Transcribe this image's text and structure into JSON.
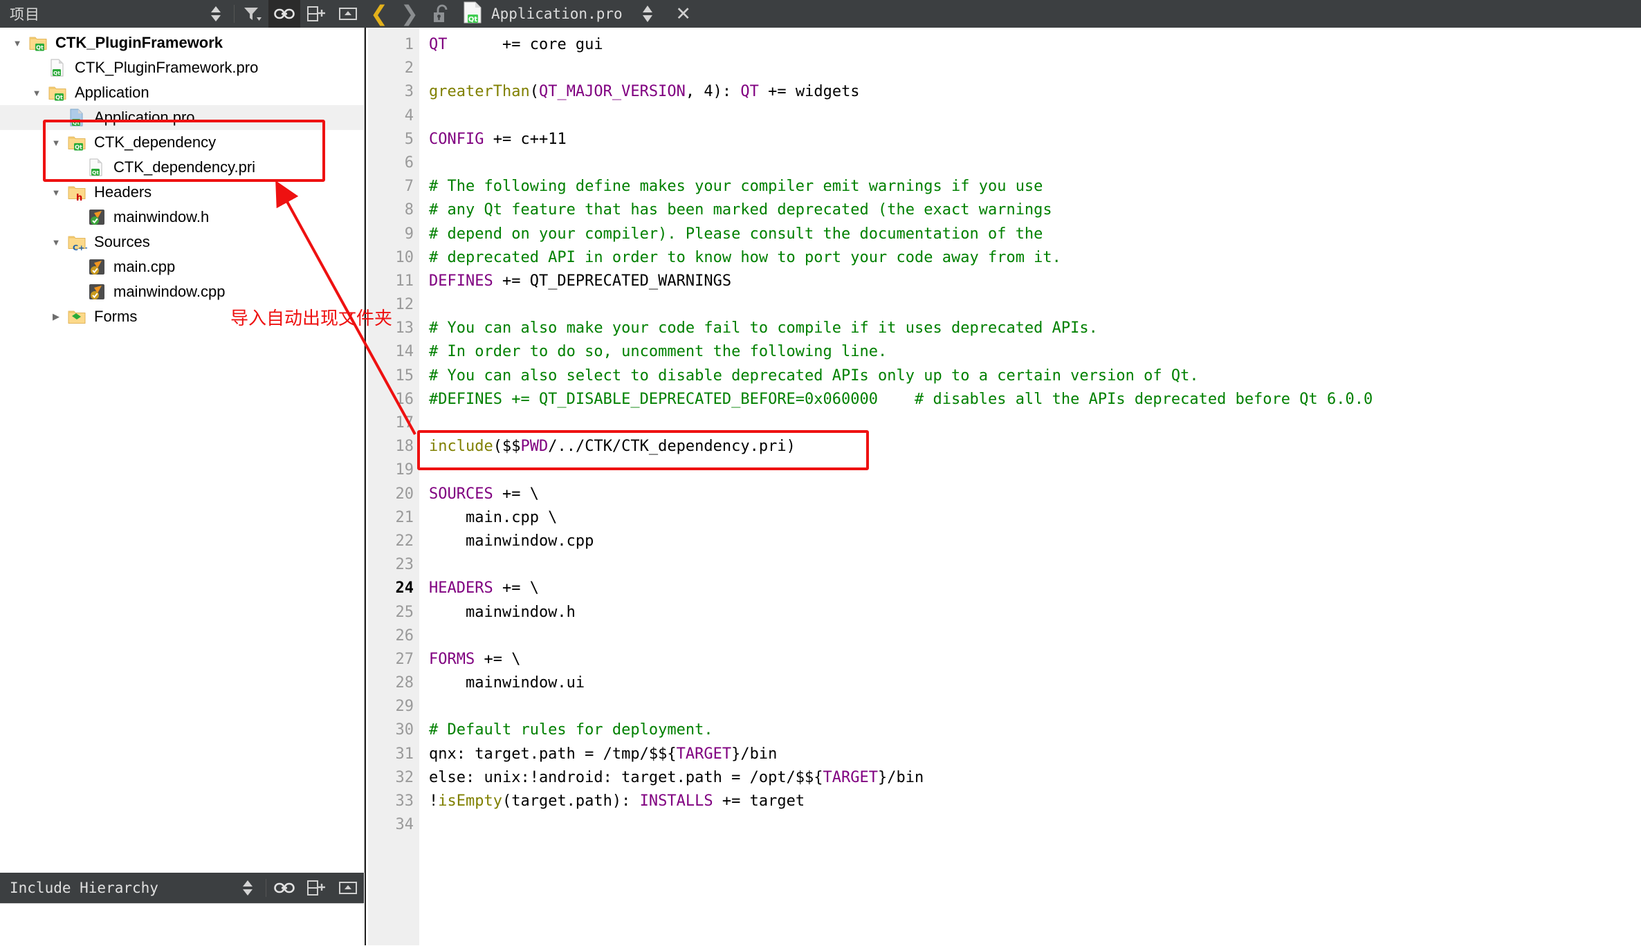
{
  "sidebar_header": {
    "title": "项目",
    "icons": [
      "sort-updown-icon",
      "filter-icon",
      "link-icon",
      "split-add-icon",
      "minimize-icon"
    ]
  },
  "editor_toolbar": {
    "back_icon": "chevron-left-icon",
    "forward_icon": "chevron-right-icon",
    "lock_icon": "unlock-icon",
    "file_icon": "qt-file-icon",
    "filename": "Application.pro",
    "updown_icon": "sort-updown-icon",
    "close_icon": "close-icon"
  },
  "tree": [
    {
      "label": "CTK_PluginFramework",
      "indent": 0,
      "arrow": "down",
      "icon": "qt-folder-icon",
      "bold": true,
      "selected": false
    },
    {
      "label": "CTK_PluginFramework.pro",
      "indent": 1,
      "arrow": "none",
      "icon": "qt-file-icon",
      "bold": false,
      "selected": false
    },
    {
      "label": "Application",
      "indent": 1,
      "arrow": "down",
      "icon": "qt-folder-icon",
      "bold": false,
      "selected": false
    },
    {
      "label": "Application.pro",
      "indent": 2,
      "arrow": "none",
      "icon": "qt-file-blue-icon",
      "bold": false,
      "selected": true
    },
    {
      "label": "CTK_dependency",
      "indent": 2,
      "arrow": "down",
      "icon": "qt-folder-icon",
      "bold": false,
      "selected": false
    },
    {
      "label": "CTK_dependency.pri",
      "indent": 3,
      "arrow": "none",
      "icon": "qt-file-icon",
      "bold": false,
      "selected": false
    },
    {
      "label": "Headers",
      "indent": 2,
      "arrow": "down",
      "icon": "h-folder-icon",
      "bold": false,
      "selected": false
    },
    {
      "label": "mainwindow.h",
      "indent": 3,
      "arrow": "none",
      "icon": "header-file-icon",
      "bold": false,
      "selected": false
    },
    {
      "label": "Sources",
      "indent": 2,
      "arrow": "down",
      "icon": "cpp-folder-icon",
      "bold": false,
      "selected": false
    },
    {
      "label": "main.cpp",
      "indent": 3,
      "arrow": "none",
      "icon": "cpp-file-icon",
      "bold": false,
      "selected": false
    },
    {
      "label": "mainwindow.cpp",
      "indent": 3,
      "arrow": "none",
      "icon": "cpp-file-icon",
      "bold": false,
      "selected": false
    },
    {
      "label": "Forms",
      "indent": 2,
      "arrow": "right",
      "icon": "forms-folder-icon",
      "bold": false,
      "selected": false
    }
  ],
  "bottom_panel": {
    "title": "Include Hierarchy",
    "icons": [
      "sort-updown-icon",
      "link-icon",
      "split-add-icon",
      "minimize-icon"
    ]
  },
  "code": {
    "lines": [
      {
        "n": 1,
        "tokens": [
          {
            "t": "QT",
            "c": "kw"
          },
          {
            "t": "      += core gui",
            "c": ""
          }
        ]
      },
      {
        "n": 2,
        "tokens": []
      },
      {
        "n": 3,
        "tokens": [
          {
            "t": "greaterThan",
            "c": "fn"
          },
          {
            "t": "(",
            "c": ""
          },
          {
            "t": "QT_MAJOR_VERSION",
            "c": "kw"
          },
          {
            "t": ", 4): ",
            "c": ""
          },
          {
            "t": "QT",
            "c": "kw"
          },
          {
            "t": " += widgets",
            "c": ""
          }
        ]
      },
      {
        "n": 4,
        "tokens": []
      },
      {
        "n": 5,
        "tokens": [
          {
            "t": "CONFIG",
            "c": "kw"
          },
          {
            "t": " += c++11",
            "c": ""
          }
        ]
      },
      {
        "n": 6,
        "tokens": []
      },
      {
        "n": 7,
        "tokens": [
          {
            "t": "# The following define makes your compiler emit warnings if you use",
            "c": "cm"
          }
        ]
      },
      {
        "n": 8,
        "tokens": [
          {
            "t": "# any Qt feature that has been marked deprecated (the exact warnings",
            "c": "cm"
          }
        ]
      },
      {
        "n": 9,
        "tokens": [
          {
            "t": "# depend on your compiler). Please consult the documentation of the",
            "c": "cm"
          }
        ]
      },
      {
        "n": 10,
        "tokens": [
          {
            "t": "# deprecated API in order to know how to port your code away from it.",
            "c": "cm"
          }
        ]
      },
      {
        "n": 11,
        "tokens": [
          {
            "t": "DEFINES",
            "c": "kw"
          },
          {
            "t": " += QT_DEPRECATED_WARNINGS",
            "c": ""
          }
        ]
      },
      {
        "n": 12,
        "tokens": []
      },
      {
        "n": 13,
        "tokens": [
          {
            "t": "# You can also make your code fail to compile if it uses deprecated APIs.",
            "c": "cm"
          }
        ]
      },
      {
        "n": 14,
        "tokens": [
          {
            "t": "# In order to do so, uncomment the following line.",
            "c": "cm"
          }
        ]
      },
      {
        "n": 15,
        "tokens": [
          {
            "t": "# You can also select to disable deprecated APIs only up to a certain version of Qt.",
            "c": "cm"
          }
        ]
      },
      {
        "n": 16,
        "tokens": [
          {
            "t": "#DEFINES += QT_DISABLE_DEPRECATED_BEFORE=0x060000    # disables all the APIs deprecated before Qt 6.0.0",
            "c": "cm"
          }
        ]
      },
      {
        "n": 17,
        "tokens": []
      },
      {
        "n": 18,
        "tokens": [
          {
            "t": "include",
            "c": "fn"
          },
          {
            "t": "($$",
            "c": ""
          },
          {
            "t": "PWD",
            "c": "kw"
          },
          {
            "t": "/../CTK/CTK_dependency.pri)",
            "c": ""
          }
        ]
      },
      {
        "n": 19,
        "tokens": []
      },
      {
        "n": 20,
        "tokens": [
          {
            "t": "SOURCES",
            "c": "kw"
          },
          {
            "t": " += \\",
            "c": ""
          }
        ]
      },
      {
        "n": 21,
        "tokens": [
          {
            "t": "    main.cpp \\",
            "c": ""
          }
        ]
      },
      {
        "n": 22,
        "tokens": [
          {
            "t": "    mainwindow.cpp",
            "c": ""
          }
        ]
      },
      {
        "n": 23,
        "tokens": []
      },
      {
        "n": 24,
        "tokens": [
          {
            "t": "HEADERS",
            "c": "kw"
          },
          {
            "t": " += \\",
            "c": ""
          }
        ]
      },
      {
        "n": 25,
        "tokens": [
          {
            "t": "    mainwindow.h",
            "c": ""
          }
        ]
      },
      {
        "n": 26,
        "tokens": []
      },
      {
        "n": 27,
        "tokens": [
          {
            "t": "FORMS",
            "c": "kw"
          },
          {
            "t": " += \\",
            "c": ""
          }
        ]
      },
      {
        "n": 28,
        "tokens": [
          {
            "t": "    mainwindow.ui",
            "c": ""
          }
        ]
      },
      {
        "n": 29,
        "tokens": []
      },
      {
        "n": 30,
        "tokens": [
          {
            "t": "# Default rules for deployment.",
            "c": "cm"
          }
        ]
      },
      {
        "n": 31,
        "tokens": [
          {
            "t": "qnx: target.path = /tmp/$${",
            "c": ""
          },
          {
            "t": "TARGET",
            "c": "kw"
          },
          {
            "t": "}/bin",
            "c": ""
          }
        ]
      },
      {
        "n": 32,
        "tokens": [
          {
            "t": "else: unix:!android: target.path = /opt/$${",
            "c": ""
          },
          {
            "t": "TARGET",
            "c": "kw"
          },
          {
            "t": "}/bin",
            "c": ""
          }
        ]
      },
      {
        "n": 33,
        "tokens": [
          {
            "t": "!",
            "c": ""
          },
          {
            "t": "isEmpty",
            "c": "fn"
          },
          {
            "t": "(target.path): ",
            "c": ""
          },
          {
            "t": "INSTALLS",
            "c": "kw"
          },
          {
            "t": " += target",
            "c": ""
          }
        ]
      },
      {
        "n": 34,
        "tokens": []
      }
    ],
    "current_line": 24
  },
  "annotations": {
    "note_text": "导入自动出现文件夹",
    "color": "#ee1111",
    "boxes": [
      "tree-ctk-dependency-box",
      "include-line-box"
    ],
    "arrow": "red-arrow-pointing-to-tree"
  }
}
